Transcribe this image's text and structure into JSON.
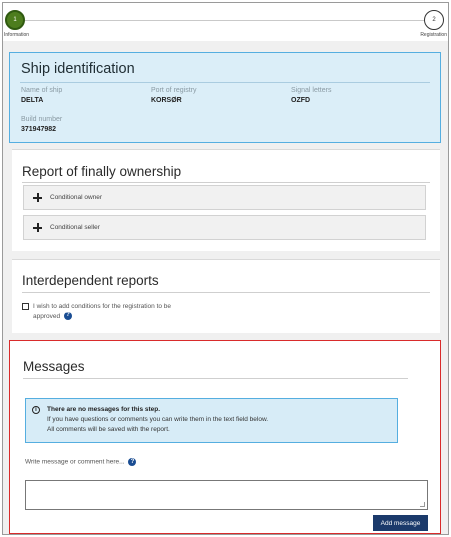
{
  "stepper": {
    "steps": [
      {
        "number": "1",
        "label": "Information"
      },
      {
        "number": "2",
        "label": "Registration"
      }
    ]
  },
  "ship": {
    "title": "Ship identification",
    "name_label": "Name of ship",
    "name_value": "DELTA",
    "port_label": "Port of registry",
    "port_value": "KORSØR",
    "signal_label": "Signal letters",
    "signal_value": "OZFD",
    "build_label": "Build number",
    "build_value": "371947982"
  },
  "ownership": {
    "title": "Report of finally ownership",
    "items": [
      {
        "label": "Conditional owner"
      },
      {
        "label": "Conditional seller"
      }
    ]
  },
  "interdependent": {
    "title": "Interdependent reports",
    "checkbox_line1": "I wish to add conditions for the registration to be",
    "checkbox_line2": "approved"
  },
  "messages": {
    "title": "Messages",
    "info_title": "There are no messages for this step.",
    "info_line1": "If you have questions or comments you can write them in the text field below.",
    "info_line2": "All comments will be saved with the report.",
    "write_label": "Write message or comment here...",
    "add_button": "Add message"
  },
  "colors": {
    "accent": "#1b3a6b",
    "info_bg": "#d7ecf7",
    "highlight_border": "#d92b2b",
    "step_active": "#4d7d1e"
  }
}
